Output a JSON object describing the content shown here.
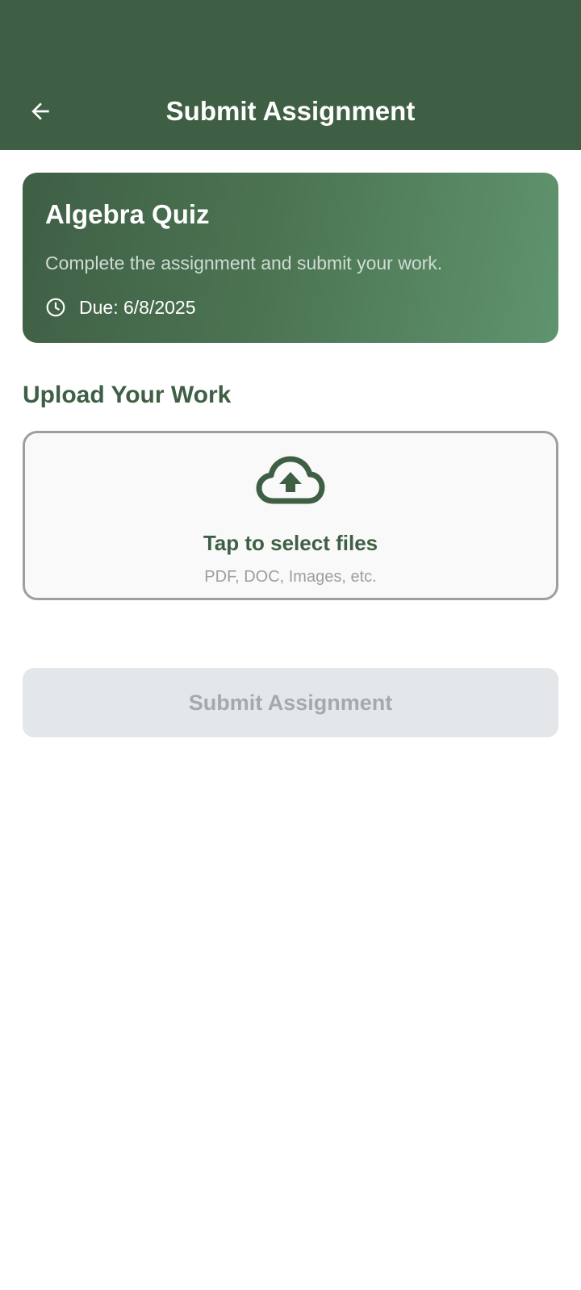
{
  "app_bar": {
    "title": "Submit Assignment",
    "back_icon": "arrow-left-icon",
    "background": "#3f5f45"
  },
  "assignment": {
    "title": "Algebra Quiz",
    "description": "Complete the assignment and submit your work.",
    "due_icon": "clock-icon",
    "due_label": "Due: 6/8/2025"
  },
  "upload": {
    "heading": "Upload Your Work",
    "icon": "cloud-upload-icon",
    "title": "Tap to select files",
    "hint": "PDF, DOC, Images, etc."
  },
  "submit": {
    "label": "Submit Assignment",
    "enabled": false
  },
  "colors": {
    "primary": "#3f5f45",
    "accent": "#5f946e",
    "disabled_bg": "#e3e7ea",
    "disabled_text": "#a4a9af"
  }
}
